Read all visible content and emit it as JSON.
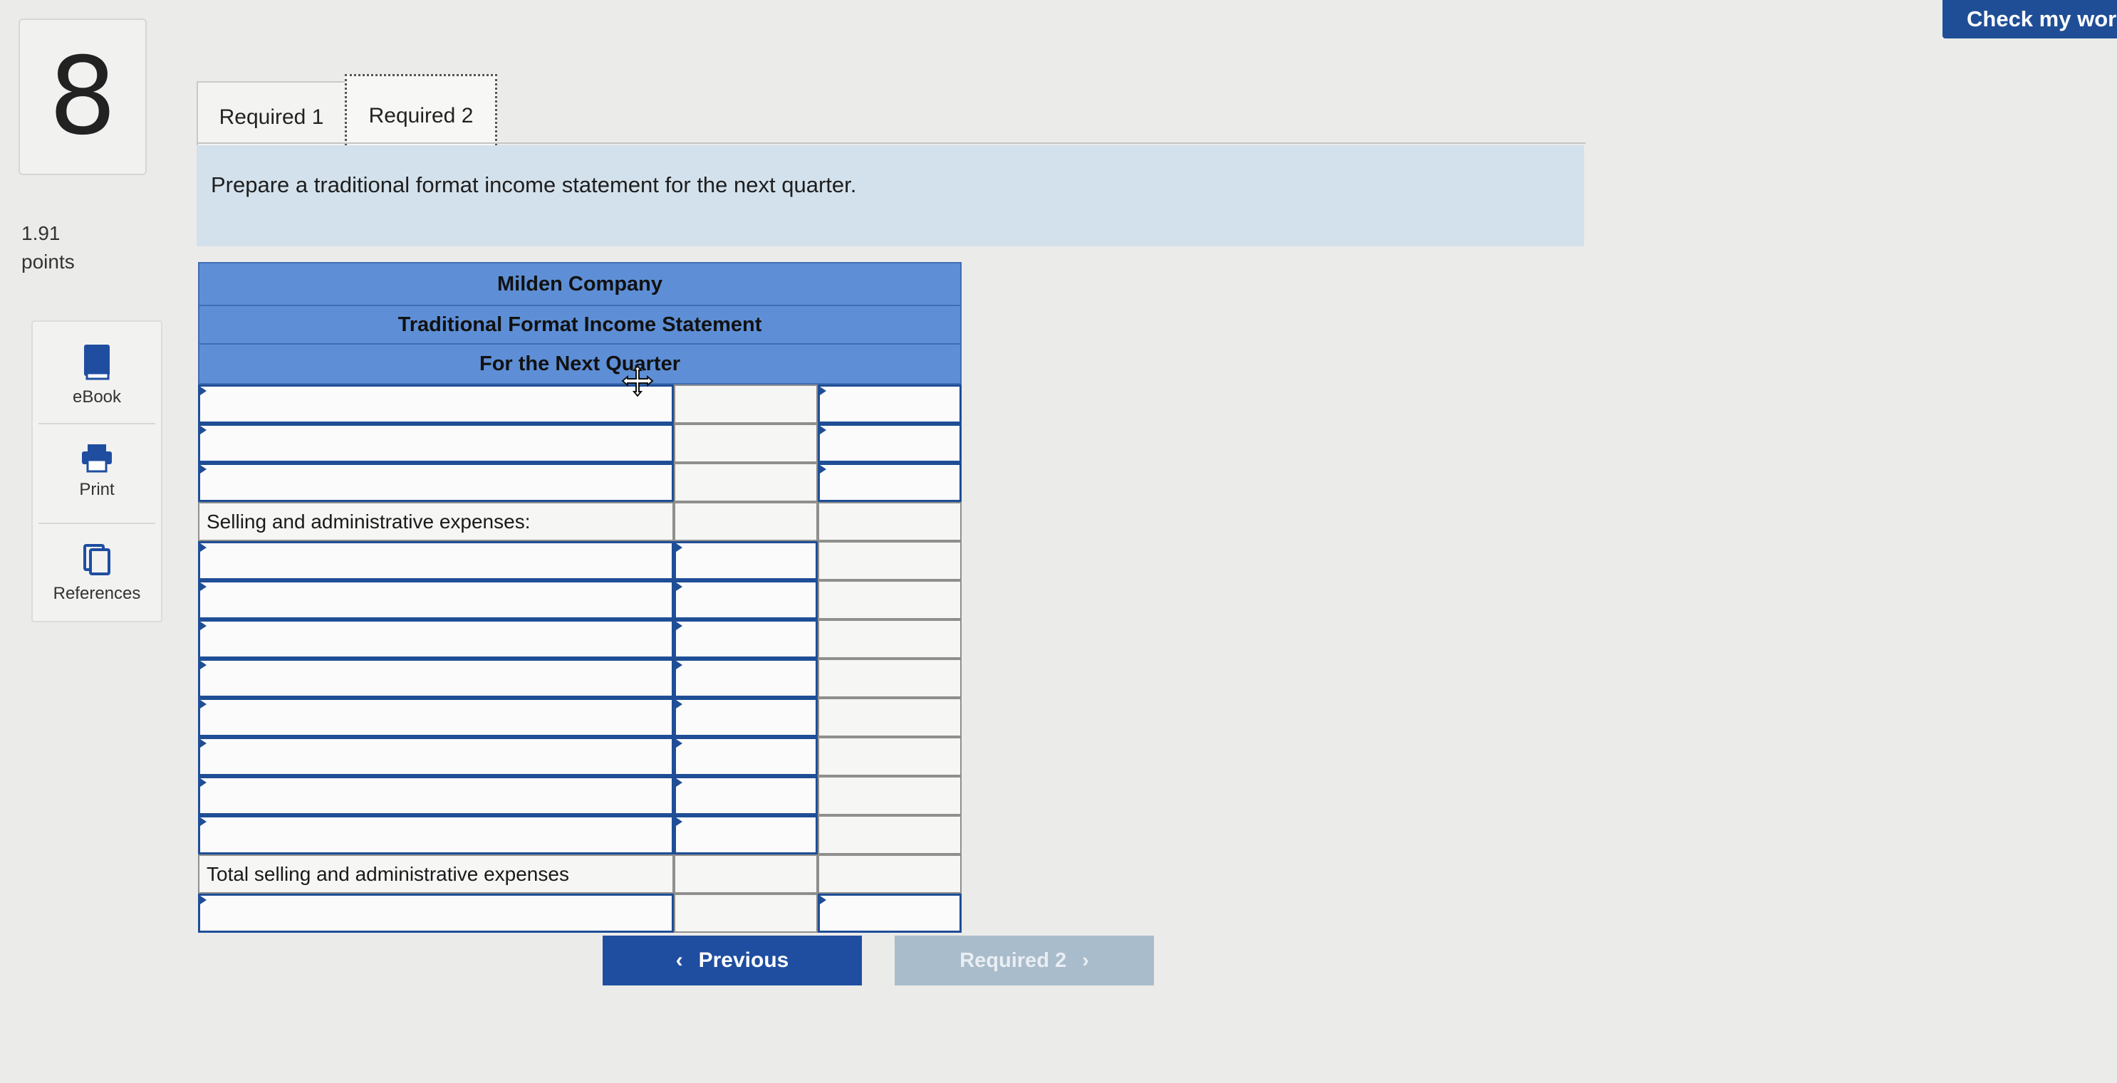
{
  "header": {
    "check_label": "Check my wor"
  },
  "question": {
    "number": "8",
    "points_value": "1.91",
    "points_label": "points"
  },
  "tools": [
    {
      "label": "eBook",
      "icon": "ebook-icon"
    },
    {
      "label": "Print",
      "icon": "print-icon"
    },
    {
      "label": "References",
      "icon": "references-icon"
    }
  ],
  "tabs": {
    "tab1": "Required 1",
    "tab2": "Required 2",
    "active": "Required 2"
  },
  "instruction": "Prepare a traditional format income statement for the next quarter.",
  "statement": {
    "company": "Milden Company",
    "title": "Traditional Format Income Statement",
    "period": "For the Next Quarter",
    "sga_label": "Selling and administrative expenses:",
    "total_sga_label": "Total selling and administrative expenses"
  },
  "nav": {
    "prev_label": "Previous",
    "next_label": "Required 2"
  },
  "colors": {
    "accent": "#1f4e96",
    "header_fill": "#5e8fd6",
    "instruction_bg": "#d3e1ec",
    "disabled": "#a9bccb"
  }
}
